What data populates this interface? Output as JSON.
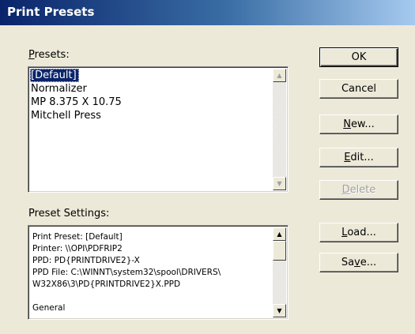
{
  "window": {
    "title": "Print Presets"
  },
  "presets": {
    "label": "Presets:",
    "items": [
      "[Default]",
      "Normalizer",
      "MP 8.375 X 10.75",
      "Mitchell Press"
    ],
    "selected_index": 0
  },
  "settings": {
    "label": "Preset Settings:",
    "lines": [
      "Print Preset: [Default]",
      "Printer: \\\\OPI\\PDFRIP2",
      "PPD: PD{PRINTDRIVE2}-X",
      "PPD File: C:\\WINNT\\system32\\spool\\DRIVERS\\",
      "W32X86\\3\\PD{PRINTDRIVE2}X.PPD",
      "",
      "General"
    ]
  },
  "buttons": {
    "ok": "OK",
    "cancel": "Cancel",
    "new": "New...",
    "edit": "Edit...",
    "delete": "Delete",
    "load": "Load...",
    "save": "Save..."
  },
  "icons": {
    "scroll_up": "scroll-up-arrow-icon",
    "scroll_down": "scroll-down-arrow-icon"
  }
}
